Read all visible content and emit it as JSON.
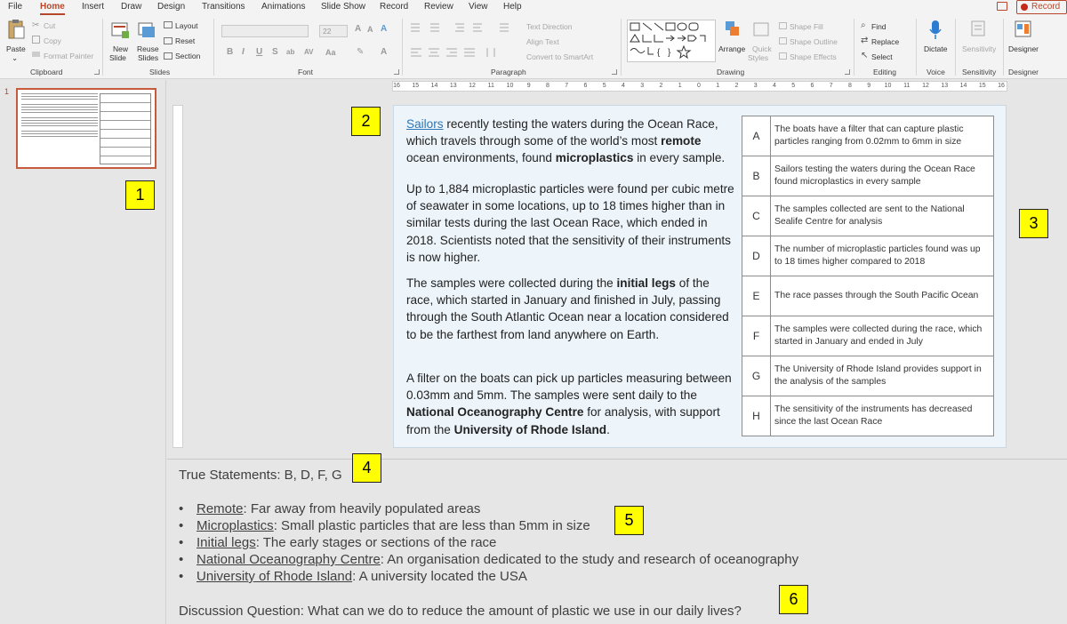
{
  "menu": {
    "tabs": [
      "File",
      "Home",
      "Insert",
      "Draw",
      "Design",
      "Transitions",
      "Animations",
      "Slide Show",
      "Record",
      "Review",
      "View",
      "Help"
    ],
    "active": "Home",
    "record_label": "Record"
  },
  "ribbon": {
    "clipboard": {
      "paste": "Paste",
      "cut": "Cut",
      "copy": "Copy",
      "format_painter": "Format Painter",
      "label": "Clipboard"
    },
    "slides": {
      "new_slide_1": "New",
      "new_slide_2": "Slide",
      "reuse_1": "Reuse",
      "reuse_2": "Slides",
      "layout": "Layout",
      "reset": "Reset",
      "section": "Section",
      "label": "Slides"
    },
    "font": {
      "size": "22",
      "label": "Font",
      "bold": "B",
      "italic": "I",
      "underline": "U",
      "strike": "S",
      "shadow": "ab",
      "case": "Aa",
      "spacing": "AV"
    },
    "paragraph": {
      "text_direction": "Text Direction",
      "align_text": "Align Text",
      "convert_smartart": "Convert to SmartArt",
      "label": "Paragraph"
    },
    "drawing": {
      "arrange": "Arrange",
      "quick_styles_1": "Quick",
      "quick_styles_2": "Styles",
      "shape_fill": "Shape Fill",
      "shape_outline": "Shape Outline",
      "shape_effects": "Shape Effects",
      "label": "Drawing"
    },
    "editing": {
      "find": "Find",
      "replace": "Replace",
      "select": "Select",
      "label": "Editing"
    },
    "voice": {
      "dictate": "Dictate",
      "label": "Voice"
    },
    "sensitivity": {
      "button": "Sensitivity",
      "label": "Sensitivity"
    },
    "designer": {
      "button": "Designer",
      "label": "Designer"
    }
  },
  "thumbnail": {
    "number": "1"
  },
  "ruler": {
    "labels": [
      "16",
      "15",
      "14",
      "13",
      "12",
      "11",
      "10",
      "9",
      "8",
      "7",
      "6",
      "5",
      "4",
      "3",
      "2",
      "1",
      "0",
      "1",
      "2",
      "3",
      "4",
      "5",
      "6",
      "7",
      "8",
      "9",
      "10",
      "11",
      "12",
      "13",
      "14",
      "15",
      "16"
    ]
  },
  "slide": {
    "p1": {
      "link": "Sailors",
      "t1": " recently testing the waters during the Ocean Race, which travels through some of the world’s most ",
      "b1": "remote",
      "t2": " ocean environments, found ",
      "b2": "microplastics",
      "t3": " in every sample."
    },
    "p2": "Up to 1,884 microplastic particles were found per cubic metre of seawater in some locations, up to 18 times higher than in similar tests during the last Ocean Race, which ended in 2018. Scientists noted that the sensitivity of their instruments is now higher.",
    "p3": {
      "t1": "The samples were collected during the ",
      "b1": "initial legs",
      "t2": " of the race, which started in January and finished in July, passing through the South Atlantic Ocean near a location considered to be the farthest from land anywhere on Earth."
    },
    "p4": {
      "t1": "A filter on the boats can pick up particles measuring between 0.03mm and 5mm. The samples were sent daily to the ",
      "b1": "National Oceanography Centre",
      "t2": " for analysis, with support from the ",
      "b2": "University of Rhode Island",
      "t3": "."
    },
    "statements": [
      {
        "letter": "A",
        "text": "The boats have a filter that can capture plastic particles ranging from 0.02mm to 6mm in size"
      },
      {
        "letter": "B",
        "text": "Sailors testing the waters during the Ocean Race found microplastics in every sample"
      },
      {
        "letter": "C",
        "text": "The samples collected are sent to the National Sealife Centre for analysis"
      },
      {
        "letter": "D",
        "text": "The number of microplastic particles found was up to 18 times higher compared to 2018"
      },
      {
        "letter": "E",
        "text": "The race passes through the South Pacific Ocean"
      },
      {
        "letter": "F",
        "text": "The samples were collected during the race, which started in January and ended in July"
      },
      {
        "letter": "G",
        "text": "The University of Rhode Island provides support in the analysis of the samples"
      },
      {
        "letter": "H",
        "text": "The sensitivity of the instruments has decreased since the last Ocean Race"
      }
    ]
  },
  "notes": {
    "true_statements": "True Statements: B, D, F, G",
    "vocab": [
      {
        "term": "Remote",
        "def": ": Far away from heavily populated areas"
      },
      {
        "term": "Microplastics",
        "def": ": Small plastic particles that are less than 5mm in size"
      },
      {
        "term": "Initial legs",
        "def": ": The early stages or sections of the race"
      },
      {
        "term": "National Oceanography Centre",
        "def": ": An organisation dedicated to the study and research of oceanography"
      },
      {
        "term": "University of Rhode Island",
        "def": ": A university located the USA"
      }
    ],
    "discussion": "Discussion Question: What can we do to reduce the amount of plastic we use in our daily lives?"
  },
  "callouts": [
    "1",
    "2",
    "3",
    "4",
    "5",
    "6"
  ],
  "colors": {
    "accent": "#b7472a",
    "callout": "#ffff00",
    "slide_bg": "#edf5fb",
    "link": "#2e75b6"
  }
}
